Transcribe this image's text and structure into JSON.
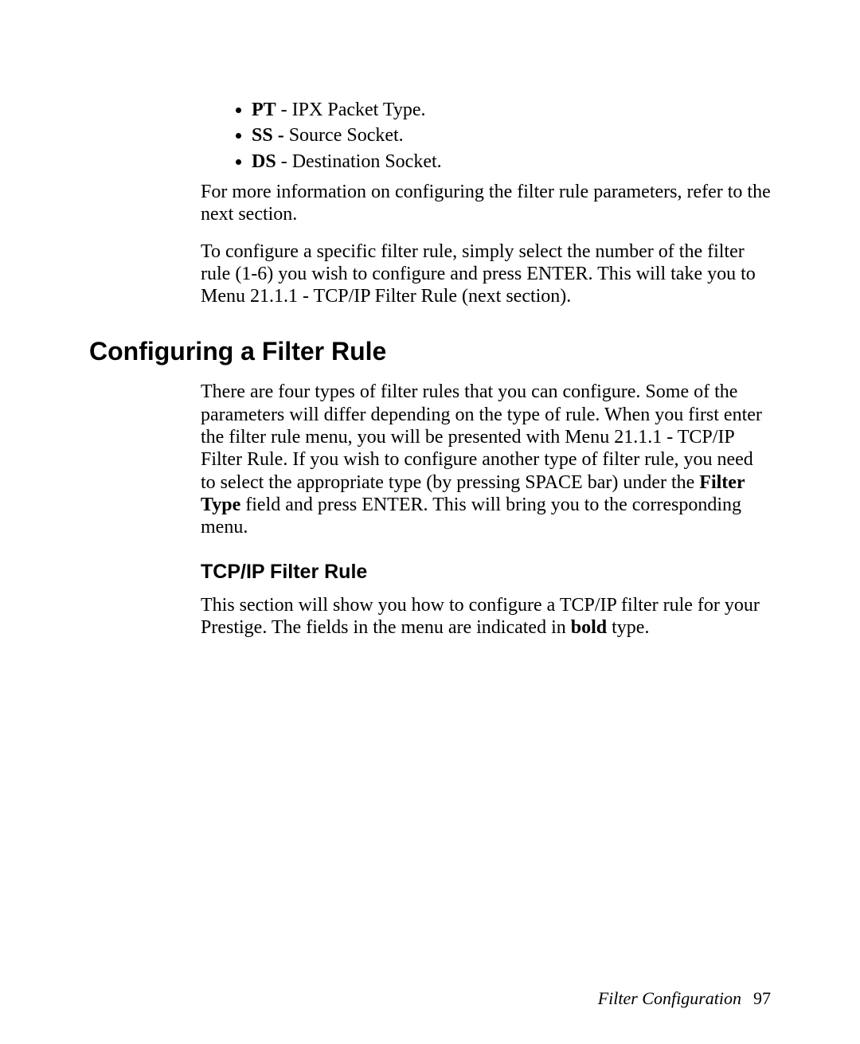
{
  "bullets": [
    {
      "term": "PT",
      "sep": " - ",
      "desc": "IPX Packet Type."
    },
    {
      "term": "SS",
      "sep": " - ",
      "desc": "Source Socket."
    },
    {
      "term": "DS",
      "sep": " - ",
      "desc": "Destination Socket."
    }
  ],
  "para1": "For more information on configuring the filter rule parameters, refer to the next section.",
  "para2": "To configure a specific filter rule, simply select the number of the filter rule (1-6) you wish to configure and press ENTER. This will take you to Menu 21.1.1 - TCP/IP Filter Rule (next section).",
  "section_heading": "Configuring a Filter Rule",
  "section_para_a": "There are four types of filter rules that you can configure. Some of the parameters will differ depending on the type of rule. When you first enter the filter rule menu, you will be presented with Menu 21.1.1 - TCP/IP Filter Rule. If you wish to configure another type of filter rule, you need to select the appropriate type (by pressing SPACE bar) under the ",
  "section_para_bold": "Filter Type",
  "section_para_b": " field and press ENTER. This will bring you to the corresponding menu.",
  "subsection_heading": "TCP/IP Filter Rule",
  "sub_para_a": "This section will show you how to configure a TCP/IP filter rule for your Prestige. The fields in the menu are indicated in ",
  "sub_para_bold": "bold",
  "sub_para_b": " type.",
  "footer_label": "Filter Configuration",
  "footer_page": "97"
}
